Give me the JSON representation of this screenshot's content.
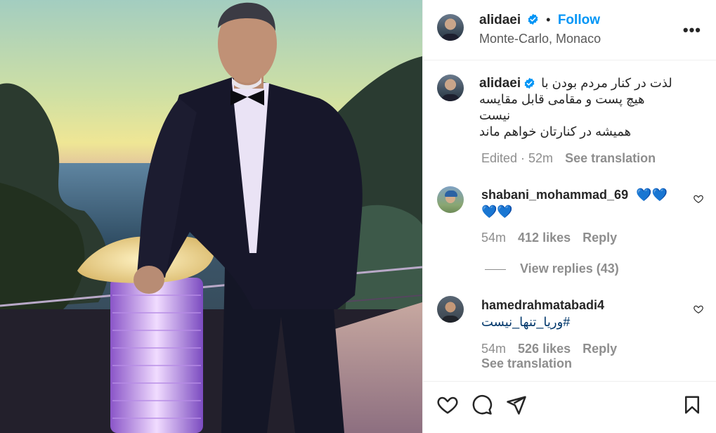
{
  "post": {
    "username": "alidaei",
    "follow_label": "Follow",
    "separator": "•",
    "location": "Monte-Carlo, Monaco",
    "more_label": "•••",
    "caption_lines": [
      "لذت در کنار مردم بودن با",
      "هیچ پست و مقامی قابل مقایسه",
      "نیست",
      "همیشه در کنارتان خواهم ماند"
    ],
    "caption_edited": "Edited · 52m",
    "see_translation": "See translation"
  },
  "comments": [
    {
      "username": "shabani_mohammad_69",
      "emoji_line1": "💙💙",
      "emoji_line2": "💙💙",
      "time": "54m",
      "likes": "412 likes",
      "reply": "Reply",
      "view_replies": "View replies (43)"
    },
    {
      "username": "hamedrahmatabadi4",
      "text": "#وریا_تنها_نیست",
      "time": "54m",
      "likes": "526 likes",
      "reply": "Reply",
      "see_translation": "See translation"
    }
  ],
  "icons": {
    "verified": "verified-badge-icon",
    "like": "heart-icon",
    "comment": "comment-bubble-icon",
    "share": "paper-plane-icon",
    "save": "bookmark-icon",
    "more": "more-options-icon"
  },
  "colors": {
    "accent": "#0095f6",
    "muted": "#8e8e8e",
    "text": "#262626",
    "heart_blue": "#1f6fd6"
  }
}
